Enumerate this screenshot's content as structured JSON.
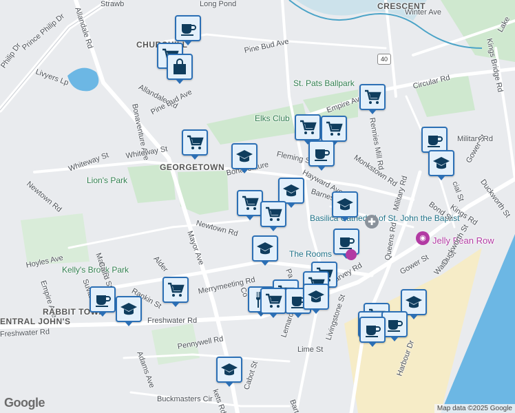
{
  "map": {
    "colors": {
      "water": "#6cb7e4",
      "park": "#cfe8cf",
      "road": "#ffffff",
      "downtown": "#f6ecc7",
      "land": "#e9ebee"
    },
    "highway_shield": "40",
    "labels": [
      {
        "text": "CRESCENT",
        "cls": "big"
      },
      {
        "text": "Winter Ave",
        "cls": ""
      },
      {
        "text": "Long Pond",
        "cls": ""
      },
      {
        "text": "Strawb",
        "cls": ""
      },
      {
        "text": "Allandale Rd",
        "cls": ""
      },
      {
        "text": "Prince Philip Dr",
        "cls": ""
      },
      {
        "text": "Philip Dr",
        "cls": ""
      },
      {
        "text": "CHURCHILL",
        "cls": "big"
      },
      {
        "text": "Pine Bud Ave",
        "cls": ""
      },
      {
        "text": "Livyers Lp",
        "cls": ""
      },
      {
        "text": "Allandale Rd",
        "cls": ""
      },
      {
        "text": "Pine Bud Ave",
        "cls": ""
      },
      {
        "text": "Bonaventure Ave",
        "cls": ""
      },
      {
        "text": "St. Pats Ballpark",
        "cls": "park"
      },
      {
        "text": "Elks Club",
        "cls": "park"
      },
      {
        "text": "Circular Rd",
        "cls": ""
      },
      {
        "text": "Kings Bridge Rd",
        "cls": ""
      },
      {
        "text": "Empire Ave",
        "cls": ""
      },
      {
        "text": "Whiteway St",
        "cls": ""
      },
      {
        "text": "Whiteway St",
        "cls": ""
      },
      {
        "text": "GEORGETOWN",
        "cls": "big"
      },
      {
        "text": "Bonaventure",
        "cls": ""
      },
      {
        "text": "Fleming St",
        "cls": ""
      },
      {
        "text": "Hayward Ave",
        "cls": ""
      },
      {
        "text": "Monkstown Rd",
        "cls": ""
      },
      {
        "text": "Rennies Mill Rd",
        "cls": ""
      },
      {
        "text": "Military Rd",
        "cls": ""
      },
      {
        "text": "Lion's Park",
        "cls": "park"
      },
      {
        "text": "Newtown Rd",
        "cls": ""
      },
      {
        "text": "Kelly's Brook Park",
        "cls": "park"
      },
      {
        "text": "Newtown Rd",
        "cls": ""
      },
      {
        "text": "Barnes",
        "cls": ""
      },
      {
        "text": "Basilica Cathedral of St. John the Baptist",
        "cls": "poi"
      },
      {
        "text": "Bond St",
        "cls": ""
      },
      {
        "text": "Kings Rd",
        "cls": ""
      },
      {
        "text": "Duckworth St",
        "cls": ""
      },
      {
        "text": "Gower St",
        "cls": ""
      },
      {
        "text": "Jelly Bean Row",
        "cls": "jelly"
      },
      {
        "text": "The Rooms",
        "cls": "poi"
      },
      {
        "text": "Mayor Ave",
        "cls": ""
      },
      {
        "text": "Malta St",
        "cls": ""
      },
      {
        "text": "Cairo St",
        "cls": ""
      },
      {
        "text": "Alder",
        "cls": ""
      },
      {
        "text": "Hoyles Ave",
        "cls": ""
      },
      {
        "text": "Empire Ave",
        "cls": ""
      },
      {
        "text": "Suvla St",
        "cls": ""
      },
      {
        "text": "Rankin St",
        "cls": ""
      },
      {
        "text": "Merrymeeting Rd",
        "cls": ""
      },
      {
        "text": "RABBIT TOWN",
        "cls": "big"
      },
      {
        "text": "ENTRAL JOHN'S",
        "cls": "big"
      },
      {
        "text": "Freshwater Rd",
        "cls": ""
      },
      {
        "text": "Freshwater Rd",
        "cls": ""
      },
      {
        "text": "Harvey Rd",
        "cls": ""
      },
      {
        "text": "Queens Rd",
        "cls": ""
      },
      {
        "text": "Gower St",
        "cls": ""
      },
      {
        "text": "Water St",
        "cls": ""
      },
      {
        "text": "Duckworth St",
        "cls": ""
      },
      {
        "text": "Lemarchant Rd",
        "cls": ""
      },
      {
        "text": "Livingstone St",
        "cls": ""
      },
      {
        "text": "Lime St",
        "cls": ""
      },
      {
        "text": "Harbour Dr",
        "cls": ""
      },
      {
        "text": "Adams Ave",
        "cls": ""
      },
      {
        "text": "Pennywell Rd",
        "cls": ""
      },
      {
        "text": "Buckmasters Cir",
        "cls": ""
      },
      {
        "text": "kets Rd",
        "cls": ""
      },
      {
        "text": "Cabot St",
        "cls": ""
      },
      {
        "text": "Bart",
        "cls": ""
      },
      {
        "text": "Military Rd",
        "cls": ""
      },
      {
        "text": "Lake",
        "cls": ""
      },
      {
        "text": "Pa",
        "cls": ""
      },
      {
        "text": "Co",
        "cls": ""
      },
      {
        "text": "F",
        "cls": ""
      },
      {
        "text": "Banr",
        "cls": "park"
      },
      {
        "text": "cial St",
        "cls": ""
      },
      {
        "text": "WN",
        "cls": "big"
      }
    ],
    "markers": [
      {
        "icon": "coffee-icon"
      },
      {
        "icon": "cart-icon"
      },
      {
        "icon": "shopping-bag-icon"
      },
      {
        "icon": "cart-icon"
      },
      {
        "icon": "cart-icon"
      },
      {
        "icon": "cart-icon"
      },
      {
        "icon": "cart-icon"
      },
      {
        "icon": "coffee-icon"
      },
      {
        "icon": "coffee-icon"
      },
      {
        "icon": "school-icon"
      },
      {
        "icon": "school-icon"
      },
      {
        "icon": "school-icon"
      },
      {
        "icon": "school-icon"
      },
      {
        "icon": "cart-icon"
      },
      {
        "icon": "cart-icon"
      },
      {
        "icon": "school-icon"
      },
      {
        "icon": "coffee-icon"
      },
      {
        "icon": "school-icon"
      },
      {
        "icon": "cart-icon"
      },
      {
        "icon": "cart-icon"
      },
      {
        "icon": "cart-icon"
      },
      {
        "icon": "cart-icon"
      },
      {
        "icon": "restaurant-icon"
      },
      {
        "icon": "cart-icon"
      },
      {
        "icon": "coffee-icon"
      },
      {
        "icon": "coffee-icon"
      },
      {
        "icon": "school-icon"
      },
      {
        "icon": "cart-icon"
      },
      {
        "icon": "coffee-icon"
      },
      {
        "icon": "coffee-icon"
      },
      {
        "icon": "coffee-icon"
      },
      {
        "icon": "school-icon"
      },
      {
        "icon": "school-icon"
      }
    ],
    "cathedral_icon": "cross-icon",
    "jelly_icon": "camera-icon"
  },
  "footer": {
    "logo": "Google",
    "attribution": "Map data ©2025 Google"
  }
}
